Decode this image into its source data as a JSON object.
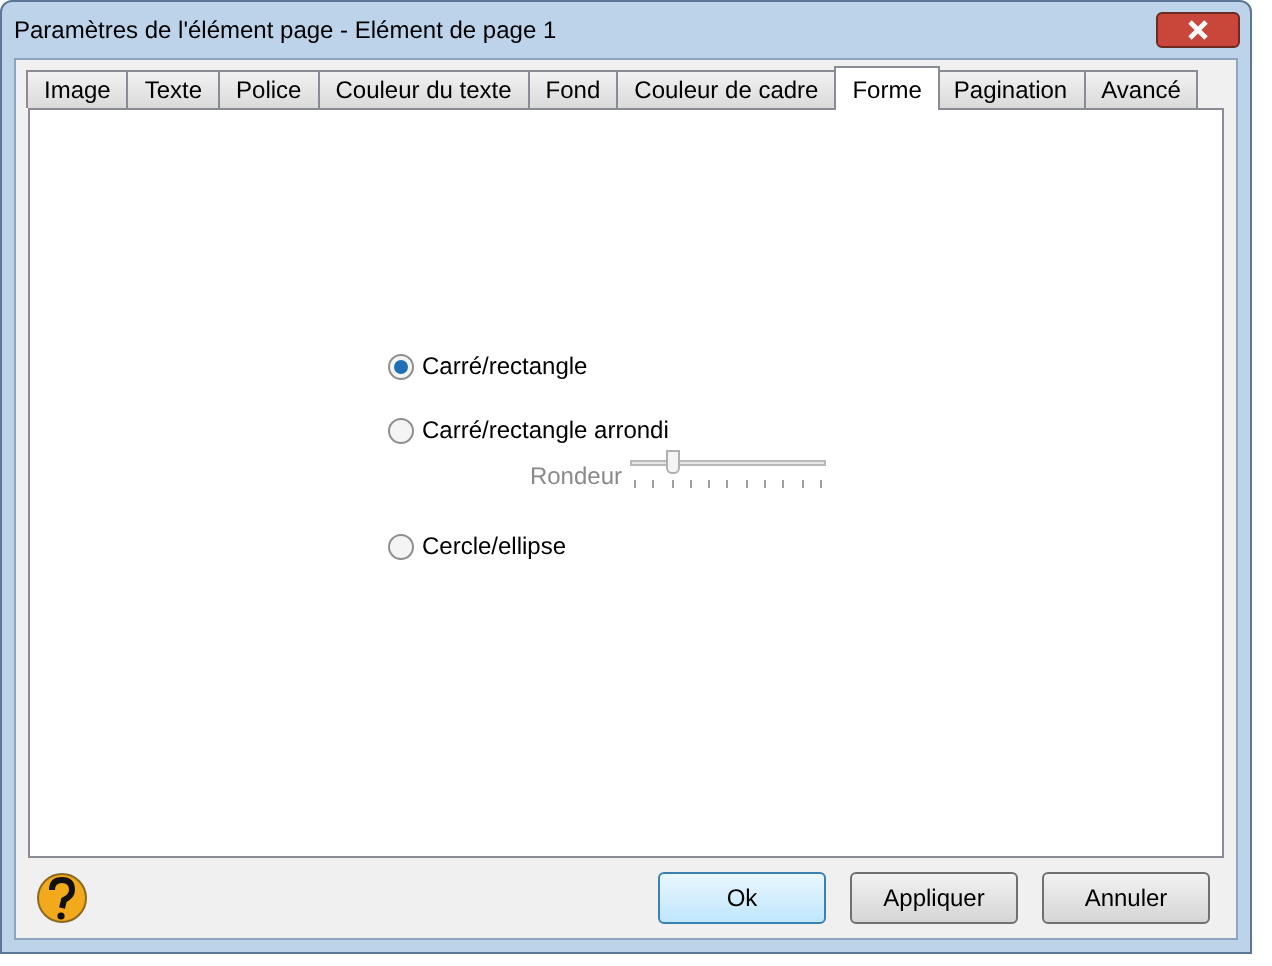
{
  "window": {
    "title": "Paramètres de l'élément page - Elément de page 1"
  },
  "tabs": [
    {
      "label": "Image",
      "selected": false
    },
    {
      "label": "Texte",
      "selected": false
    },
    {
      "label": "Police",
      "selected": false
    },
    {
      "label": "Couleur du texte",
      "selected": false
    },
    {
      "label": "Fond",
      "selected": false
    },
    {
      "label": "Couleur de cadre",
      "selected": false
    },
    {
      "label": "Forme",
      "selected": true
    },
    {
      "label": "Pagination",
      "selected": false
    },
    {
      "label": "Avancé",
      "selected": false
    }
  ],
  "shape_options": [
    {
      "kind": "radio",
      "label": "Carré/rectangle",
      "selected": true
    },
    {
      "kind": "radio",
      "label": "Carré/rectangle arrondi",
      "selected": false
    },
    {
      "kind": "slider",
      "label": "Rondeur",
      "level": 0.2,
      "disabled": true
    },
    {
      "kind": "radio",
      "label": "Cercle/ellipse",
      "selected": false
    }
  ],
  "buttons": [
    {
      "label": "Ok",
      "default": true
    },
    {
      "label": "Appliquer",
      "default": false
    },
    {
      "label": "Annuler",
      "default": false
    }
  ]
}
